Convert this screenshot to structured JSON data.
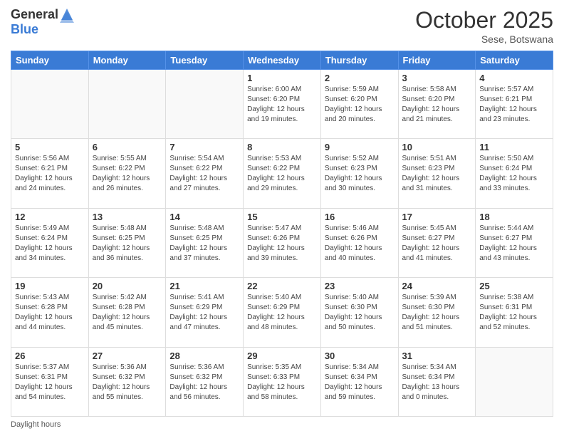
{
  "header": {
    "logo_general": "General",
    "logo_blue": "Blue",
    "month_title": "October 2025",
    "location": "Sese, Botswana"
  },
  "days_of_week": [
    "Sunday",
    "Monday",
    "Tuesday",
    "Wednesday",
    "Thursday",
    "Friday",
    "Saturday"
  ],
  "weeks": [
    [
      {
        "day": "",
        "info": ""
      },
      {
        "day": "",
        "info": ""
      },
      {
        "day": "",
        "info": ""
      },
      {
        "day": "1",
        "info": "Sunrise: 6:00 AM\nSunset: 6:20 PM\nDaylight: 12 hours\nand 19 minutes."
      },
      {
        "day": "2",
        "info": "Sunrise: 5:59 AM\nSunset: 6:20 PM\nDaylight: 12 hours\nand 20 minutes."
      },
      {
        "day": "3",
        "info": "Sunrise: 5:58 AM\nSunset: 6:20 PM\nDaylight: 12 hours\nand 21 minutes."
      },
      {
        "day": "4",
        "info": "Sunrise: 5:57 AM\nSunset: 6:21 PM\nDaylight: 12 hours\nand 23 minutes."
      }
    ],
    [
      {
        "day": "5",
        "info": "Sunrise: 5:56 AM\nSunset: 6:21 PM\nDaylight: 12 hours\nand 24 minutes."
      },
      {
        "day": "6",
        "info": "Sunrise: 5:55 AM\nSunset: 6:22 PM\nDaylight: 12 hours\nand 26 minutes."
      },
      {
        "day": "7",
        "info": "Sunrise: 5:54 AM\nSunset: 6:22 PM\nDaylight: 12 hours\nand 27 minutes."
      },
      {
        "day": "8",
        "info": "Sunrise: 5:53 AM\nSunset: 6:22 PM\nDaylight: 12 hours\nand 29 minutes."
      },
      {
        "day": "9",
        "info": "Sunrise: 5:52 AM\nSunset: 6:23 PM\nDaylight: 12 hours\nand 30 minutes."
      },
      {
        "day": "10",
        "info": "Sunrise: 5:51 AM\nSunset: 6:23 PM\nDaylight: 12 hours\nand 31 minutes."
      },
      {
        "day": "11",
        "info": "Sunrise: 5:50 AM\nSunset: 6:24 PM\nDaylight: 12 hours\nand 33 minutes."
      }
    ],
    [
      {
        "day": "12",
        "info": "Sunrise: 5:49 AM\nSunset: 6:24 PM\nDaylight: 12 hours\nand 34 minutes."
      },
      {
        "day": "13",
        "info": "Sunrise: 5:48 AM\nSunset: 6:25 PM\nDaylight: 12 hours\nand 36 minutes."
      },
      {
        "day": "14",
        "info": "Sunrise: 5:48 AM\nSunset: 6:25 PM\nDaylight: 12 hours\nand 37 minutes."
      },
      {
        "day": "15",
        "info": "Sunrise: 5:47 AM\nSunset: 6:26 PM\nDaylight: 12 hours\nand 39 minutes."
      },
      {
        "day": "16",
        "info": "Sunrise: 5:46 AM\nSunset: 6:26 PM\nDaylight: 12 hours\nand 40 minutes."
      },
      {
        "day": "17",
        "info": "Sunrise: 5:45 AM\nSunset: 6:27 PM\nDaylight: 12 hours\nand 41 minutes."
      },
      {
        "day": "18",
        "info": "Sunrise: 5:44 AM\nSunset: 6:27 PM\nDaylight: 12 hours\nand 43 minutes."
      }
    ],
    [
      {
        "day": "19",
        "info": "Sunrise: 5:43 AM\nSunset: 6:28 PM\nDaylight: 12 hours\nand 44 minutes."
      },
      {
        "day": "20",
        "info": "Sunrise: 5:42 AM\nSunset: 6:28 PM\nDaylight: 12 hours\nand 45 minutes."
      },
      {
        "day": "21",
        "info": "Sunrise: 5:41 AM\nSunset: 6:29 PM\nDaylight: 12 hours\nand 47 minutes."
      },
      {
        "day": "22",
        "info": "Sunrise: 5:40 AM\nSunset: 6:29 PM\nDaylight: 12 hours\nand 48 minutes."
      },
      {
        "day": "23",
        "info": "Sunrise: 5:40 AM\nSunset: 6:30 PM\nDaylight: 12 hours\nand 50 minutes."
      },
      {
        "day": "24",
        "info": "Sunrise: 5:39 AM\nSunset: 6:30 PM\nDaylight: 12 hours\nand 51 minutes."
      },
      {
        "day": "25",
        "info": "Sunrise: 5:38 AM\nSunset: 6:31 PM\nDaylight: 12 hours\nand 52 minutes."
      }
    ],
    [
      {
        "day": "26",
        "info": "Sunrise: 5:37 AM\nSunset: 6:31 PM\nDaylight: 12 hours\nand 54 minutes."
      },
      {
        "day": "27",
        "info": "Sunrise: 5:36 AM\nSunset: 6:32 PM\nDaylight: 12 hours\nand 55 minutes."
      },
      {
        "day": "28",
        "info": "Sunrise: 5:36 AM\nSunset: 6:32 PM\nDaylight: 12 hours\nand 56 minutes."
      },
      {
        "day": "29",
        "info": "Sunrise: 5:35 AM\nSunset: 6:33 PM\nDaylight: 12 hours\nand 58 minutes."
      },
      {
        "day": "30",
        "info": "Sunrise: 5:34 AM\nSunset: 6:34 PM\nDaylight: 12 hours\nand 59 minutes."
      },
      {
        "day": "31",
        "info": "Sunrise: 5:34 AM\nSunset: 6:34 PM\nDaylight: 13 hours\nand 0 minutes."
      },
      {
        "day": "",
        "info": ""
      }
    ]
  ],
  "footer": {
    "daylight_hours_label": "Daylight hours"
  }
}
